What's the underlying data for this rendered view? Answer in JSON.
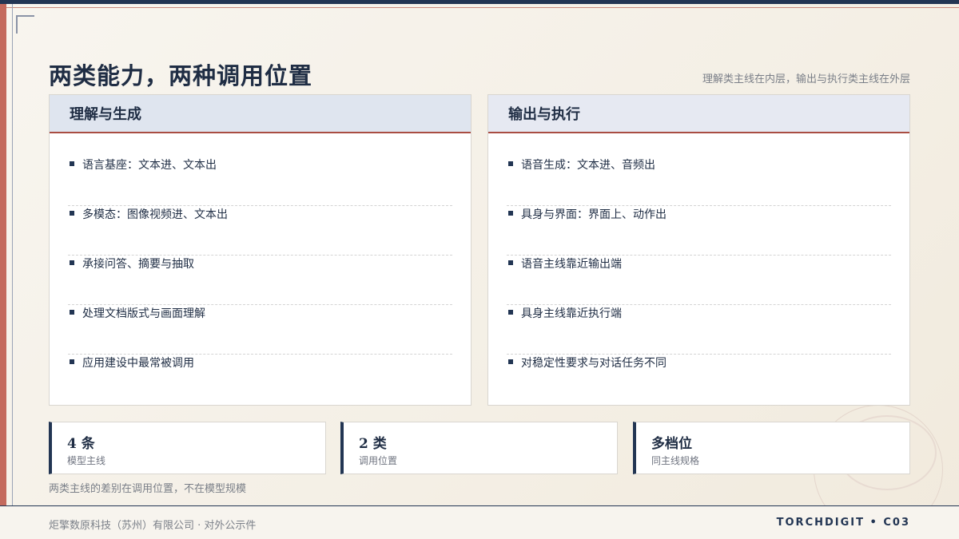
{
  "header": {
    "title": "两类能力，两种调用位置",
    "subtitle": "理解类主线在内层，输出与执行类主线在外层"
  },
  "cards": [
    {
      "title": "理解与生成",
      "items": [
        "语言基座：文本进、文本出",
        "多模态：图像视频进、文本出",
        "承接问答、摘要与抽取",
        "处理文档版式与画面理解",
        "应用建设中最常被调用"
      ]
    },
    {
      "title": "输出与执行",
      "items": [
        "语音生成：文本进、音频出",
        "具身与界面：界面上、动作出",
        "语音主线靠近输出端",
        "具身主线靠近执行端",
        "对稳定性要求与对话任务不同"
      ]
    }
  ],
  "stats": [
    {
      "value": "4 条",
      "label": "模型主线"
    },
    {
      "value": "2 类",
      "label": "调用位置"
    },
    {
      "value": "多档位",
      "label": "同主线规格"
    }
  ],
  "note": "两类主线的差别在调用位置，不在模型规模",
  "footer": {
    "left": "炬擎数原科技（苏州）有限公司 · 对外公示件",
    "right": "TORCHDIGIT • C03"
  },
  "colors": {
    "navy": "#223553",
    "accent_red": "#a94d42",
    "left_bar": "#c46a5d"
  }
}
